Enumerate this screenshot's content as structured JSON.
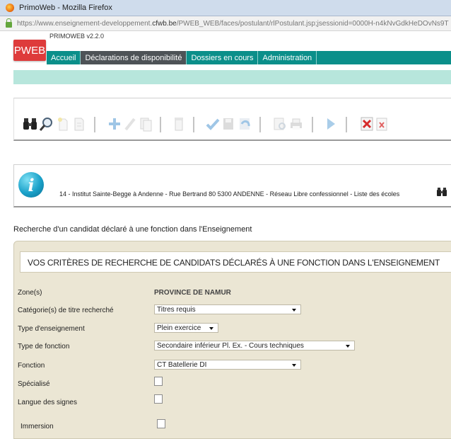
{
  "window": {
    "title": "PrimoWeb - Mozilla Firefox",
    "url_prefix": "https://www.enseignement-developpement.",
    "url_domain": "cfwb.be",
    "url_suffix": "/PWEB_WEB/faces/postulant/rlPostulant.jsp;jsessionid=0000H-n4kNvGdkHeDOvNs9T"
  },
  "app": {
    "version": "PRIMOWEB v2.2.0",
    "logo": "PWEB",
    "nav": [
      "Accueil",
      "Déclarations de disponibilité",
      "Dossiers en cours",
      "Administration"
    ],
    "active_nav": "Déclarations de disponibilité"
  },
  "toolbar": {
    "icons": [
      "binoculars-icon",
      "magnifier-icon",
      "new-document-icon",
      "document-icon",
      "add-icon",
      "edit-icon",
      "copy-icon",
      "delete-icon",
      "validate-icon",
      "save-icon",
      "undo-icon",
      "preview-icon",
      "print-icon",
      "play-icon",
      "excel-export-icon",
      "excel-icon"
    ]
  },
  "info": {
    "text": "14 - Institut Sainte-Begge à Andenne - Rue Bertrand 80 5300 ANDENNE - Réseau Libre confessionnel - Liste des écoles"
  },
  "section_title": "Recherche d'un candidat déclaré à une fonction dans l'Enseignement",
  "criteria": {
    "title": "VOS CRITÈRES DE RECHERCHE DE CANDIDATS DÉCLARÉS À UNE FONCTION DANS L'ENSEIGNEMENT",
    "zone_label": "Zone(s)",
    "zone_value": "PROVINCE DE NAMUR",
    "title_cat_label": "Catégorie(s) de titre recherché",
    "title_cat_value": "Titres requis",
    "teaching_type_label": "Type d'enseignement",
    "teaching_type_value": "Plein exercice",
    "function_type_label": "Type de fonction",
    "function_type_value": "Secondaire inférieur Pl. Ex. - Cours techniques",
    "function_label": "Fonction",
    "function_value": "CT Batellerie DI",
    "specialised_label": "Spécialisé",
    "sign_language_label": "Langue des signes",
    "immersion_label": "Immersion"
  },
  "colors": {
    "logo": "#de3b3b",
    "nav": "#0b8f8a",
    "nav_active": "#4e5357",
    "subbar": "#b7e6dc",
    "panel": "#ebe6d4"
  }
}
